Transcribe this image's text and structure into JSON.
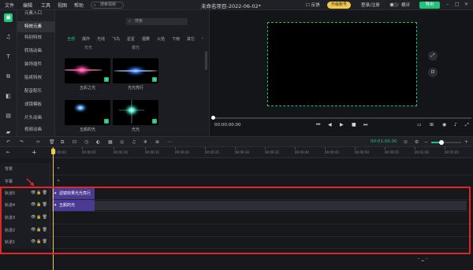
{
  "titlebar": {
    "menu": [
      "文件",
      "编辑",
      "工具",
      "视图",
      "帮助"
    ],
    "search_placeholder": "搜索视频",
    "app_title": "未命名项目-2022-06-02*",
    "feedback": "反馈",
    "upgrade": "升级账号",
    "login": "登录/注册",
    "toggle_label": "横评",
    "export": "导出"
  },
  "categories": [
    "元素入口",
    "特效元素",
    "特别特效",
    "转场动画",
    "装饰插件",
    "贴纸特效",
    "配音配乐",
    "滤镜模板",
    "片头动画",
    "视频动画",
    "素材"
  ],
  "effects": {
    "search_placeholder": "搜索",
    "filters": [
      "全部",
      "爆炸",
      "光线",
      "飞鸟",
      "星星",
      "烟雾",
      "火焰",
      "下雨",
      "其它"
    ],
    "sub_labels": [
      "光光",
      "爆光"
    ],
    "items": [
      {
        "label": "五彩之光"
      },
      {
        "label": "光光亮行"
      },
      {
        "label": "五颜的光"
      },
      {
        "label": "光光"
      }
    ]
  },
  "preview": {
    "time": "00:00:00.00",
    "controls": [
      "⏮",
      "◀",
      "▶",
      "■",
      "⏭"
    ]
  },
  "toolbar": {
    "time": "00:01:00.00"
  },
  "timeline": {
    "ticks": [
      "00:00:00",
      "00:00:05",
      "00:00:10",
      "00:00:15",
      "00:00:20",
      "00:00:25",
      "00:00:30",
      "00:00:35",
      "00:00:40",
      "00:00:45",
      "00:00:50",
      "00:00:55",
      "00:01:00",
      "00:01:05"
    ],
    "tracks": [
      {
        "name": "背景",
        "clip": ""
      },
      {
        "name": "字幕",
        "clip": ""
      },
      {
        "name": "轨道5",
        "clip": "滤镜效果光光亮行"
      },
      {
        "name": "轨道4",
        "clip": "五颜的光"
      },
      {
        "name": "轨道3",
        "clip": ""
      },
      {
        "name": "轨道2",
        "clip": ""
      },
      {
        "name": "轨道1",
        "clip": ""
      }
    ]
  },
  "colors": {
    "accent": "#21c27a",
    "upgrade": "#f2c94c",
    "clip": "#4b3a93",
    "highlight": "#e0262a"
  }
}
